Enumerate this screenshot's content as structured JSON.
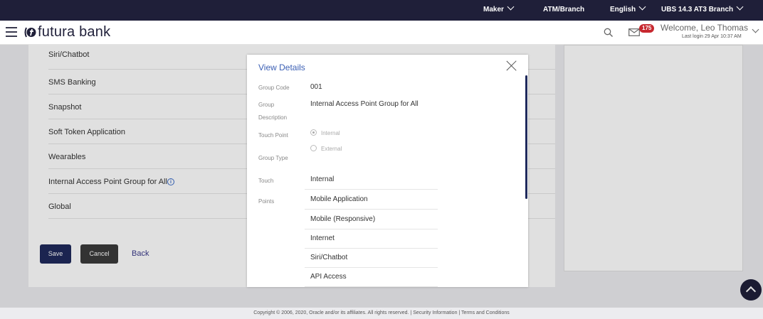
{
  "topbar": {
    "role": "Maker",
    "atm_branch": "ATM/Branch",
    "language": "English",
    "branch": "UBS 14.3 AT3 Branch"
  },
  "header": {
    "brand": "futura bank",
    "notification_count": "175",
    "welcome": "Welcome, Leo Thomas",
    "last_login": "Last login 29 Apr 10:37 AM"
  },
  "list": {
    "items": [
      "Siri/Chatbot",
      "SMS Banking",
      "Snapshot",
      "Soft Token Application",
      "Wearables",
      "Internal Access Point Group for All",
      "Global"
    ]
  },
  "actions": {
    "save": "Save",
    "cancel": "Cancel",
    "back": "Back"
  },
  "modal": {
    "title": "View Details",
    "group_code_label": "Group Code",
    "group_code": "001",
    "group_desc_label_1": "Group",
    "group_desc_label_2": "Description",
    "group_desc": "Internal Access Point Group for All",
    "touch_point_label": "Touch Point",
    "group_type_label": "Group Type",
    "radio_internal": "Internal",
    "radio_external": "External",
    "radio_selected": "Internal",
    "touch_points_label_1": "Touch",
    "touch_points_label_2": "Points",
    "touch_points": [
      "Internal",
      "Mobile Application",
      "Mobile (Responsive)",
      "Internet",
      "Siri/Chatbot",
      "API Access"
    ]
  },
  "footer": {
    "text": "Copyright © 2006, 2020, Oracle and/or its affiliates. All rights reserved. | Security Information | Terms and Conditions"
  },
  "colors": {
    "topbar": "#1f1f39",
    "accent": "#3b5fb4",
    "save_button": "#1f2a5c",
    "cancel_button": "#3b3b3b",
    "badge": "#c7282f"
  }
}
